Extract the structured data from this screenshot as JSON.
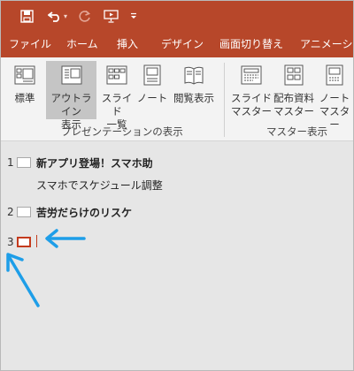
{
  "qat": {
    "icons": [
      "save-icon",
      "undo-icon",
      "redo-icon",
      "present-from-start-icon",
      "customize-qat-icon"
    ]
  },
  "tabs": [
    "ファイル",
    "ホーム",
    "挿入",
    "デザイン",
    "画面切り替え",
    "アニメーション"
  ],
  "ribbon": {
    "presentation_views": {
      "group_label": "プレゼンテーションの表示",
      "buttons": [
        {
          "label": "標準",
          "icon": "normal-view-icon",
          "selected": false
        },
        {
          "label": "アウトライン\n表示",
          "icon": "outline-view-icon",
          "selected": true
        },
        {
          "label": "スライド\n一覧",
          "icon": "slide-sorter-icon",
          "selected": false
        },
        {
          "label": "ノート\n",
          "icon": "notes-page-icon",
          "selected": false
        },
        {
          "label": "閲覧表示",
          "icon": "reading-view-icon",
          "selected": false
        }
      ]
    },
    "master_views": {
      "group_label": "マスター表示",
      "buttons": [
        {
          "label": "スライド\nマスター",
          "icon": "slide-master-icon"
        },
        {
          "label": "配布資料\nマスター",
          "icon": "handout-master-icon"
        },
        {
          "label": "ノート\nマスター",
          "icon": "notes-master-icon"
        }
      ]
    }
  },
  "outline": {
    "slides": [
      {
        "number": "1",
        "title": "新アプリ登場！スマホ助",
        "body": "スマホでスケジュール調整"
      },
      {
        "number": "2",
        "title": "苦労だらけのリスケ",
        "body": ""
      },
      {
        "number": "3",
        "title": "",
        "body": ""
      }
    ]
  },
  "colors": {
    "accent": "#b7472a",
    "selected_border": "#c43b1d",
    "annotation_arrow": "#1e9ee8"
  }
}
